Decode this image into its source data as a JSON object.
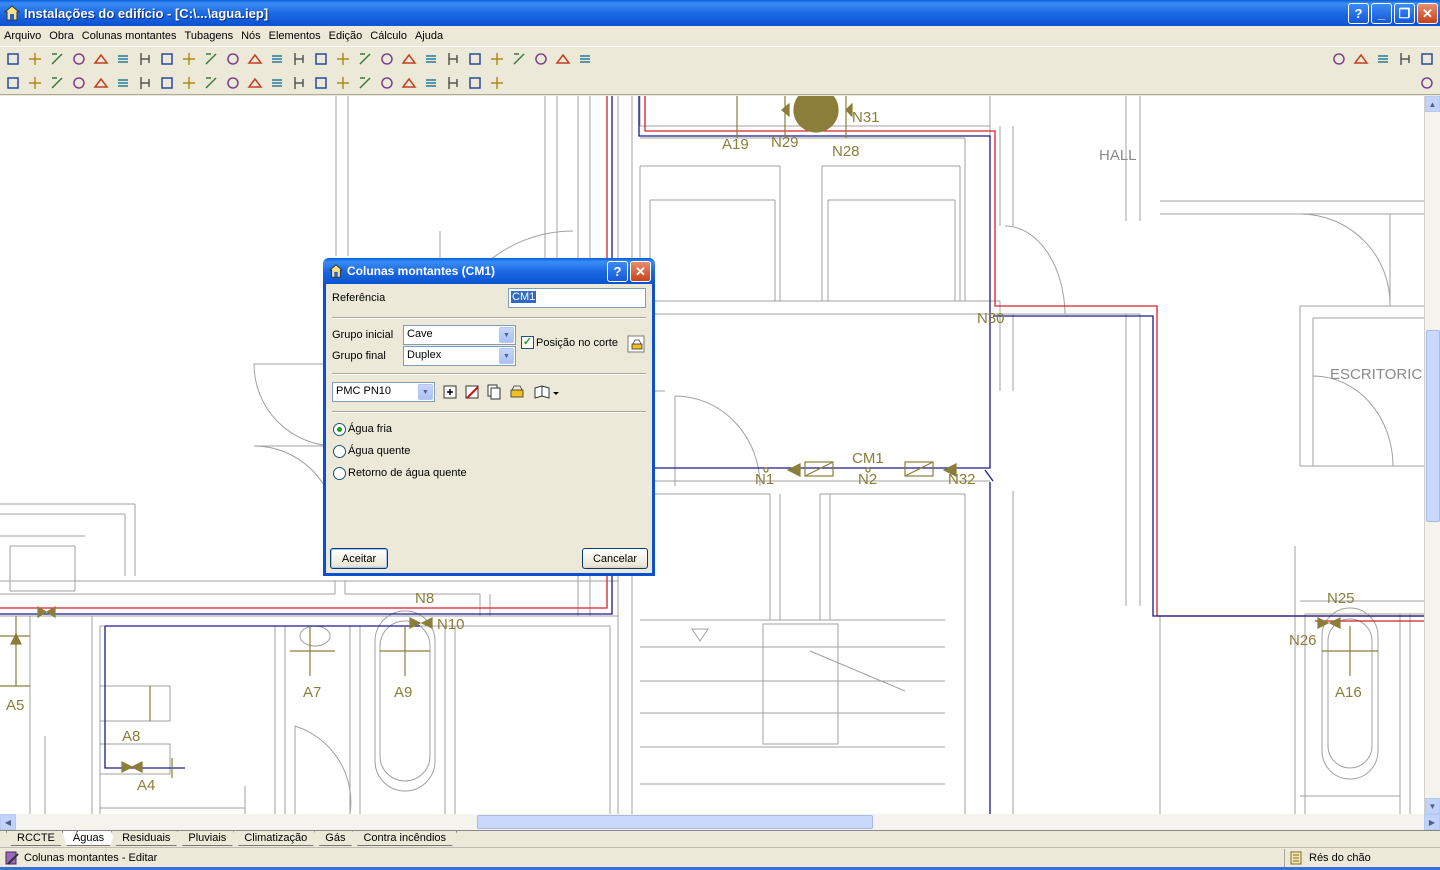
{
  "window": {
    "title": "Instalações do edifício - [C:\\...\\agua.iep]",
    "buttons": [
      "?",
      "_",
      "❐",
      "✕"
    ]
  },
  "menu": [
    "Arquivo",
    "Obra",
    "Colunas montantes",
    "Tubagens",
    "Nós",
    "Elementos",
    "Edição",
    "Cálculo",
    "Ajuda"
  ],
  "toolbar1": {
    "left_icons": [
      "open-icon",
      "save-icon",
      "valve-icon",
      "tool-icon",
      "table-icon",
      "list-icon",
      "grid-icon",
      "magnet-icon",
      "undo-icon",
      "redo-icon",
      "level-up-icon",
      "level-updown-icon",
      "level-down-icon",
      "zoom-icon",
      "zoom-all-icon",
      "zoom-window-icon",
      "zoom-out-icon",
      "pan-icon",
      "redraw-icon",
      "binoculars-icon",
      "dimension-icon",
      "angle-icon",
      "measure-icon",
      "snap-icon",
      "select-icon",
      "rectangle-icon",
      "tools-icon"
    ],
    "right_icons": [
      "globe-icon",
      "layers-icon",
      "3d-icon",
      "settings-icon",
      "close-toolbar-icon"
    ]
  },
  "toolbar2": {
    "left_icons": [
      "column-icon",
      "column-multi-icon",
      "pipe-icon",
      "tee-icon",
      "node-icon",
      "node-up-icon",
      "node-down-icon",
      "align-icon",
      "align-center-icon",
      "valve-insert-icon",
      "valve-alt-icon",
      "pencil-icon",
      "move-icon",
      "rotate-icon",
      "split-icon",
      "join-icon",
      "copy-icon",
      "erase-icon",
      "query-icon",
      "calculate-icon",
      "check-icon",
      "verify-icon",
      "error-icon"
    ],
    "right_icons": [
      "refresh-icon"
    ]
  },
  "drawing": {
    "labels": [
      "A19",
      "N29",
      "N28",
      "N31",
      "N30",
      "N1",
      "CM1",
      "N2",
      "N32",
      "N8",
      "N10",
      "A7",
      "A9",
      "A5",
      "A8",
      "A4",
      "N25",
      "N26",
      "A16"
    ],
    "rooms": [
      "HALL",
      "ESCRITORIC"
    ],
    "colors": {
      "hot": "#d4202a",
      "cold": "#1a1a8c",
      "walls": "#a0a0a0",
      "fittings": "#8b7d3a"
    }
  },
  "dialog": {
    "title": "Colunas montantes (CM1)",
    "referencia_label": "Referência",
    "referencia_value": "CM1",
    "grupo_inicial_label": "Grupo inicial",
    "grupo_inicial_value": "Cave",
    "grupo_final_label": "Grupo final",
    "grupo_final_value": "Duplex",
    "posicao_label": "Posição no corte",
    "posicao_checked": true,
    "material_value": "PMC PN10",
    "radios": [
      "Água fria",
      "Água quente",
      "Retorno de água quente"
    ],
    "radio_selected": 0,
    "ok_label": "Aceitar",
    "cancel_label": "Cancelar"
  },
  "tabs": [
    "RCCTE",
    "Águas",
    "Residuais",
    "Pluviais",
    "Climatização",
    "Gás",
    "Contra incêndios"
  ],
  "active_tab": 1,
  "status": {
    "left": "Colunas montantes - Editar",
    "right": "Rés do chão"
  }
}
